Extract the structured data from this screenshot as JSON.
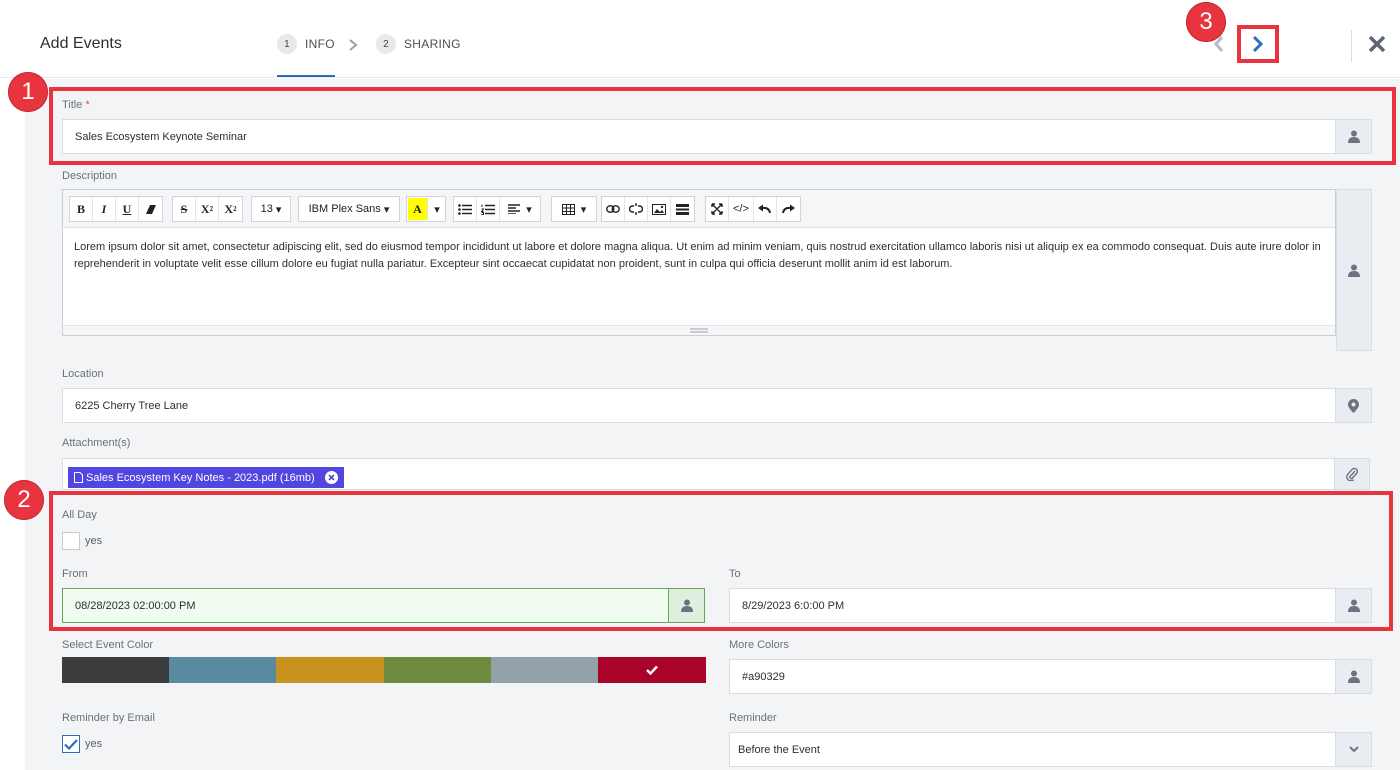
{
  "header": {
    "title": "Add Events",
    "steps": [
      {
        "num": "1",
        "label": "INFO"
      },
      {
        "num": "2",
        "label": "SHARING"
      }
    ]
  },
  "title_field": {
    "label": "Title",
    "required_mark": "*",
    "value": "Sales Ecosystem Keynote Seminar"
  },
  "description": {
    "label": "Description",
    "toolbar": {
      "font_size": "13",
      "font_family": "IBM Plex Sans"
    },
    "text": "Lorem ipsum dolor sit amet, consectetur adipiscing elit, sed do eiusmod tempor incididunt ut labore et dolore magna aliqua. Ut enim ad minim veniam, quis nostrud exercitation ullamco laboris nisi ut aliquip ex ea commodo consequat. Duis aute irure dolor in reprehenderit in voluptate velit esse cillum dolore eu fugiat nulla pariatur. Excepteur sint occaecat cupidatat non proident, sunt in culpa qui officia deserunt mollit anim id est laborum."
  },
  "location": {
    "label": "Location",
    "value": "6225 Cherry Tree Lane"
  },
  "attachments": {
    "label": "Attachment(s)",
    "file": "Sales Ecosystem Key Notes - 2023.pdf (16mb)"
  },
  "all_day": {
    "label": "All Day",
    "option": "yes",
    "checked": false
  },
  "from": {
    "label": "From",
    "value": "08/28/2023 02:00:00 PM"
  },
  "to": {
    "label": "To",
    "value": "8/29/2023 6:0:00 PM"
  },
  "event_color": {
    "label": "Select Event Color",
    "swatches": [
      "#3d3d3f",
      "#5a8aa0",
      "#c8921f",
      "#6e8a3d",
      "#93a1a8",
      "#a90329"
    ],
    "selected": "#a90329"
  },
  "more_colors": {
    "label": "More Colors",
    "value": "#a90329"
  },
  "reminder_email": {
    "label": "Reminder by Email",
    "option": "yes",
    "checked": true
  },
  "reminder": {
    "label": "Reminder",
    "value": "Before the Event"
  },
  "annotations": [
    "1",
    "2",
    "3"
  ],
  "colors": {
    "accent": "#2d6fb4",
    "highlight": "#e8343e",
    "chip": "#5146e0"
  }
}
